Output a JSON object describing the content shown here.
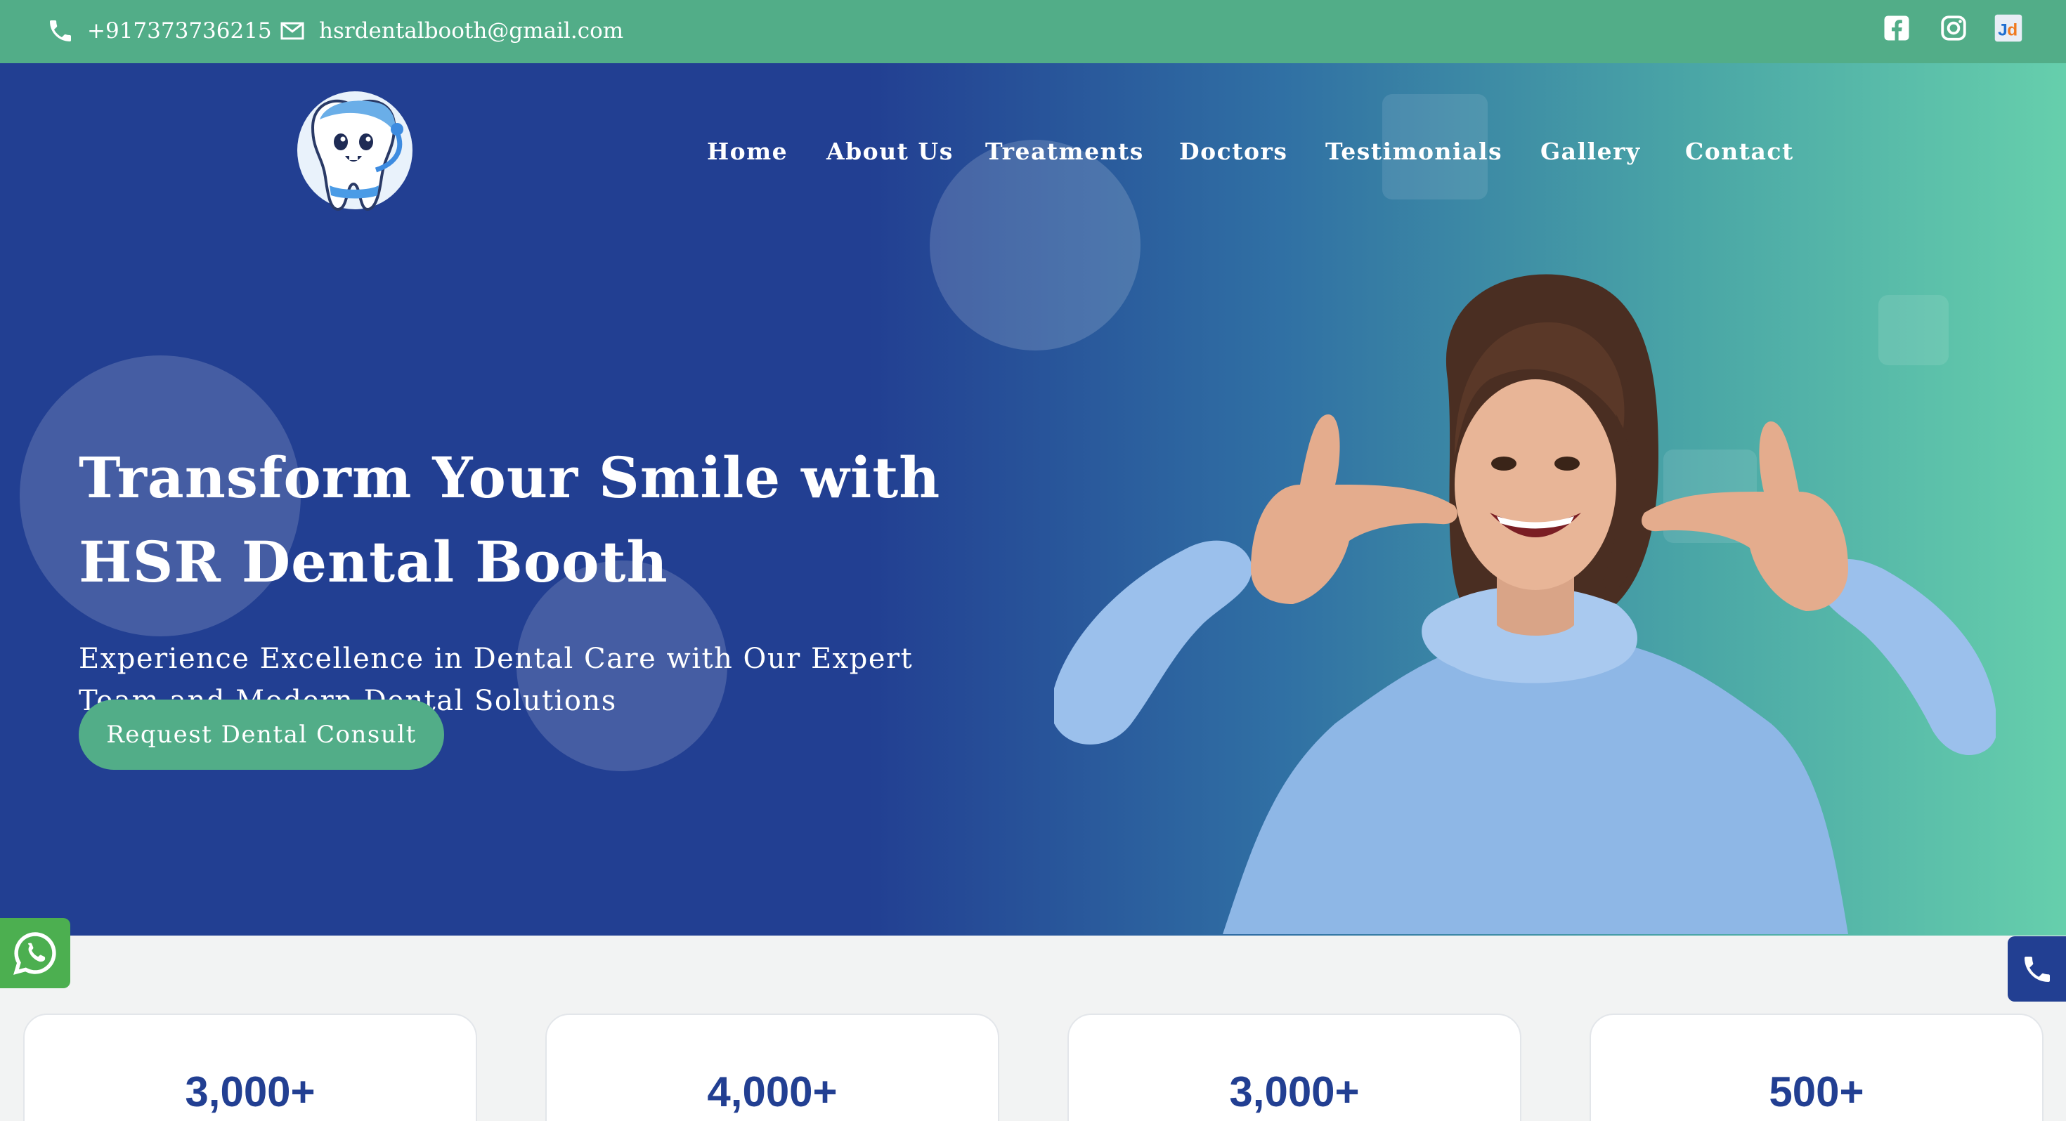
{
  "topbar": {
    "phone": "+917373736215",
    "email": "hsrdentalbooth@gmail.com",
    "socials": [
      "facebook-icon",
      "instagram-icon",
      "justdial-icon"
    ],
    "justdial_text": "Jd"
  },
  "nav": {
    "items": [
      "Home",
      "About Us",
      "Treatments",
      "Doctors",
      "Testimonials",
      "Gallery",
      "Contact"
    ]
  },
  "hero": {
    "title_line1": "Transform Your Smile with",
    "title_line2": "HSR Dental Booth",
    "subtitle_line1": "Experience Excellence in Dental Care with Our Expert",
    "subtitle_line2": "Team and Modern Dental Solutions",
    "cta_label": "Request Dental Consult"
  },
  "stats": [
    {
      "value": "3,000+"
    },
    {
      "value": "4,000+"
    },
    {
      "value": "3,000+"
    },
    {
      "value": "500+"
    }
  ],
  "colors": {
    "topbar": "#52ad88",
    "hero_dark": "#223f92",
    "hero_light": "#66cfac",
    "accent": "#52ad88",
    "stat_text": "#223f92"
  }
}
